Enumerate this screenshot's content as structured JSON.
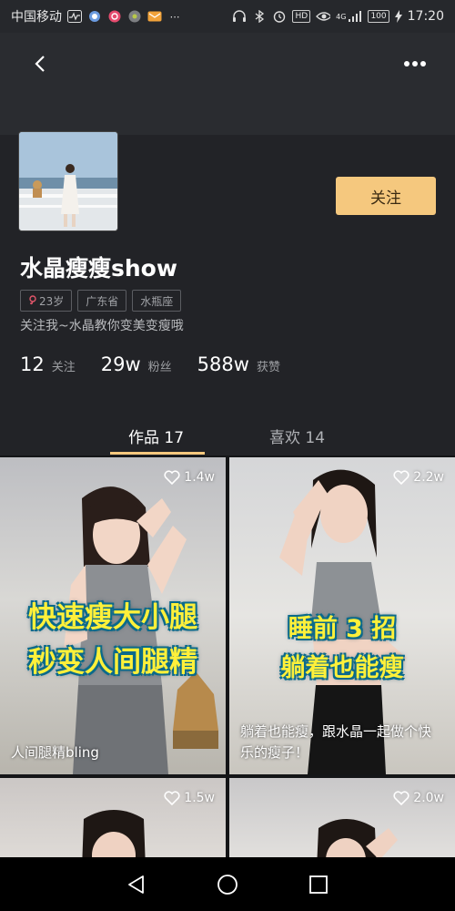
{
  "status_bar": {
    "carrier": "中国移动",
    "time": "17:20",
    "battery": "100",
    "network": "4G",
    "hd_label": "HD"
  },
  "header": {
    "back_icon": "chevron-left-icon",
    "more_icon": "more-horizontal-icon"
  },
  "profile": {
    "username": "水晶瘦瘦show",
    "follow_label": "关注",
    "tags": [
      {
        "label": "23岁",
        "icon": "female-icon"
      },
      {
        "label": "广东省"
      },
      {
        "label": "水瓶座"
      }
    ],
    "bio": "关注我~水晶教你变美变瘦哦",
    "stats": [
      {
        "num": "12",
        "label": "关注"
      },
      {
        "num": "29w",
        "label": "粉丝"
      },
      {
        "num": "588w",
        "label": "获赞"
      }
    ]
  },
  "tabs": {
    "works": "作品 17",
    "likes": "喜欢 14"
  },
  "videos": [
    {
      "likes": "1.4w",
      "overlay_lines": [
        "快速瘦大小腿",
        "秒变人间腿精"
      ],
      "caption": "人间腿精bling"
    },
    {
      "likes": "2.2w",
      "overlay_lines": [
        "睡前 3 招",
        "躺着也能瘦"
      ],
      "caption": "躺着也能瘦，跟水晶一起做个快乐的瘦子！"
    },
    {
      "likes": "1.5w"
    },
    {
      "likes": "2.0w"
    }
  ],
  "colors": {
    "accent": "#f5c87e",
    "background": "#222327",
    "overlay_text": "#fff03a"
  }
}
